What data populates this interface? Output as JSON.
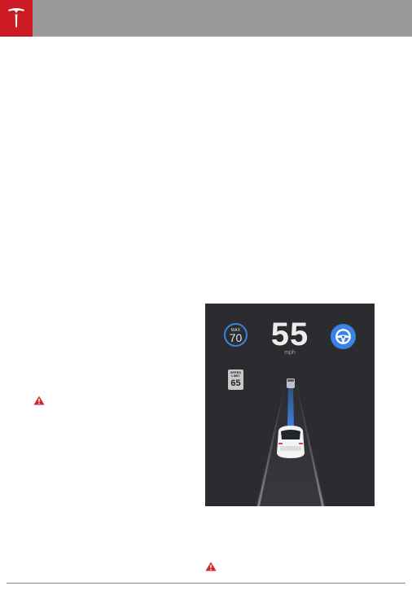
{
  "colors": {
    "header_bar": "#9a9a9a",
    "brand_red": "#cc1a22",
    "warning_red": "#d32a2a",
    "panel_bg": "#2a2c2f",
    "accent_blue": "#3a82e6"
  },
  "icons": {
    "brand_logo": "tesla-t-logo",
    "warning": "warning-triangle",
    "autosteer": "steering-wheel"
  },
  "driving_display": {
    "set_speed": {
      "label": "MAX",
      "value": "70"
    },
    "current_speed": "55",
    "speed_unit": "mph",
    "speed_limit_sign": {
      "label": "SPEED LIMIT",
      "value": "65"
    }
  }
}
